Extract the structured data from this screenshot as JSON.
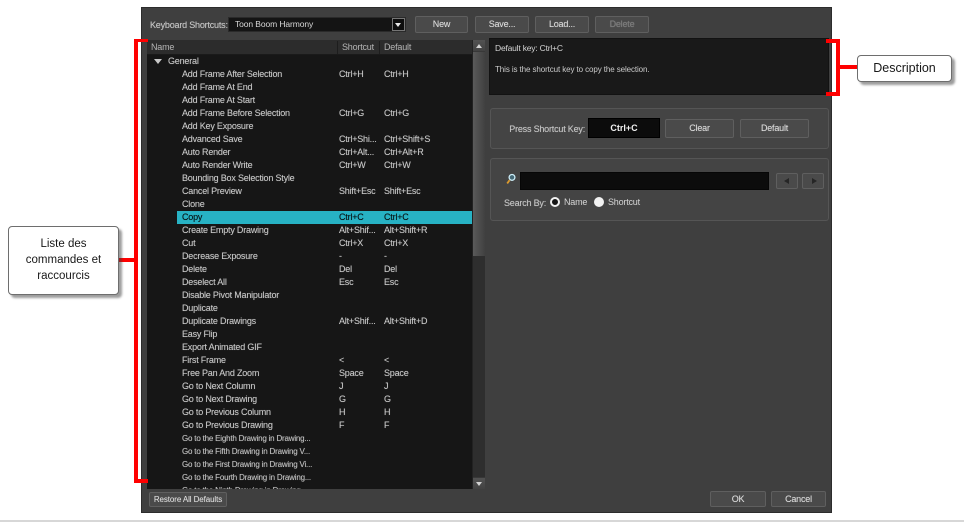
{
  "colors": {
    "dialog_background": "#3f3f3f",
    "list_background": "#161616",
    "selection_cyan": "#27b2c4",
    "annotation_red": "#ff0000"
  },
  "topbar": {
    "label": "Keyboard Shortcuts:",
    "preset_value": "Toon Boom Harmony",
    "new_label": "New",
    "save_label": "Save...",
    "load_label": "Load...",
    "delete_label": "Delete"
  },
  "list": {
    "columns": [
      "Name",
      "Shortcut",
      "Default"
    ],
    "rows": [
      {
        "kind": "group",
        "name": "General",
        "shortcut": "",
        "default": ""
      },
      {
        "kind": "item",
        "name": "Add Frame After Selection",
        "shortcut": "Ctrl+H",
        "default": "Ctrl+H"
      },
      {
        "kind": "item",
        "name": "Add Frame At End",
        "shortcut": "",
        "default": ""
      },
      {
        "kind": "item",
        "name": "Add Frame At Start",
        "shortcut": "",
        "default": ""
      },
      {
        "kind": "item",
        "name": "Add Frame Before Selection",
        "shortcut": "Ctrl+G",
        "default": "Ctrl+G"
      },
      {
        "kind": "item",
        "name": "Add Key Exposure",
        "shortcut": "",
        "default": ""
      },
      {
        "kind": "item",
        "name": "Advanced Save",
        "shortcut": "Ctrl+Shi...",
        "default": "Ctrl+Shift+S"
      },
      {
        "kind": "item",
        "name": "Auto Render",
        "shortcut": "Ctrl+Alt...",
        "default": "Ctrl+Alt+R"
      },
      {
        "kind": "item",
        "name": "Auto Render Write",
        "shortcut": "Ctrl+W",
        "default": "Ctrl+W"
      },
      {
        "kind": "item",
        "name": "Bounding Box Selection Style",
        "shortcut": "",
        "default": ""
      },
      {
        "kind": "item",
        "name": "Cancel Preview",
        "shortcut": "Shift+Esc",
        "default": "Shift+Esc"
      },
      {
        "kind": "item",
        "name": "Clone",
        "shortcut": "",
        "default": ""
      },
      {
        "kind": "item",
        "name": "Copy",
        "shortcut": "Ctrl+C",
        "default": "Ctrl+C",
        "selected": true
      },
      {
        "kind": "item",
        "name": "Create Empty Drawing",
        "shortcut": "Alt+Shif...",
        "default": "Alt+Shift+R"
      },
      {
        "kind": "item",
        "name": "Cut",
        "shortcut": "Ctrl+X",
        "default": "Ctrl+X"
      },
      {
        "kind": "item",
        "name": "Decrease Exposure",
        "shortcut": "-",
        "default": "-"
      },
      {
        "kind": "item",
        "name": "Delete",
        "shortcut": "Del",
        "default": "Del"
      },
      {
        "kind": "item",
        "name": "Deselect All",
        "shortcut": "Esc",
        "default": "Esc"
      },
      {
        "kind": "item",
        "name": "Disable Pivot Manipulator",
        "shortcut": "",
        "default": ""
      },
      {
        "kind": "item",
        "name": "Duplicate",
        "shortcut": "",
        "default": ""
      },
      {
        "kind": "item",
        "name": "Duplicate Drawings",
        "shortcut": "Alt+Shif...",
        "default": "Alt+Shift+D"
      },
      {
        "kind": "item",
        "name": "Easy Flip",
        "shortcut": "",
        "default": ""
      },
      {
        "kind": "item",
        "name": "Export Animated GIF",
        "shortcut": "",
        "default": ""
      },
      {
        "kind": "item",
        "name": "First Frame",
        "shortcut": "<",
        "default": "<"
      },
      {
        "kind": "item",
        "name": "Free Pan And Zoom",
        "shortcut": "Space",
        "default": "Space"
      },
      {
        "kind": "item",
        "name": "Go to Next Column",
        "shortcut": "J",
        "default": "J"
      },
      {
        "kind": "item",
        "name": "Go to Next Drawing",
        "shortcut": "G",
        "default": "G"
      },
      {
        "kind": "item",
        "name": "Go to Previous Column",
        "shortcut": "H",
        "default": "H"
      },
      {
        "kind": "item",
        "name": "Go to Previous Drawing",
        "shortcut": "F",
        "default": "F"
      },
      {
        "kind": "item-small",
        "name": "Go to the Eighth Drawing in Drawing...",
        "shortcut": "",
        "default": ""
      },
      {
        "kind": "item-small",
        "name": "Go to the Fifth Drawing in Drawing V...",
        "shortcut": "",
        "default": ""
      },
      {
        "kind": "item-small",
        "name": "Go to the First Drawing in Drawing Vi...",
        "shortcut": "",
        "default": ""
      },
      {
        "kind": "item-small",
        "name": "Go to the Fourth Drawing in Drawing...",
        "shortcut": "",
        "default": ""
      },
      {
        "kind": "item-small",
        "name": "Go to the Ninth Drawing in Drawing...",
        "shortcut": "",
        "default": ""
      }
    ]
  },
  "description_panel": {
    "default_key_line": "Default key: Ctrl+C",
    "description_line": "This is the shortcut key to copy the selection."
  },
  "shortcut_editor": {
    "label": "Press Shortcut Key:",
    "key_value": "Ctrl+C",
    "clear_label": "Clear",
    "default_label": "Default"
  },
  "search": {
    "input_value": "",
    "search_by_label": "Search By:",
    "options": [
      {
        "label": "Name",
        "selected": true
      },
      {
        "label": "Shortcut",
        "selected": false
      }
    ]
  },
  "footer": {
    "restore_label": "Restore All Defaults",
    "ok_label": "OK",
    "cancel_label": "Cancel"
  },
  "annotations": {
    "left_callout_lines": [
      "Liste des",
      "commandes et",
      "raccourcis"
    ],
    "right_callout": "Description"
  }
}
